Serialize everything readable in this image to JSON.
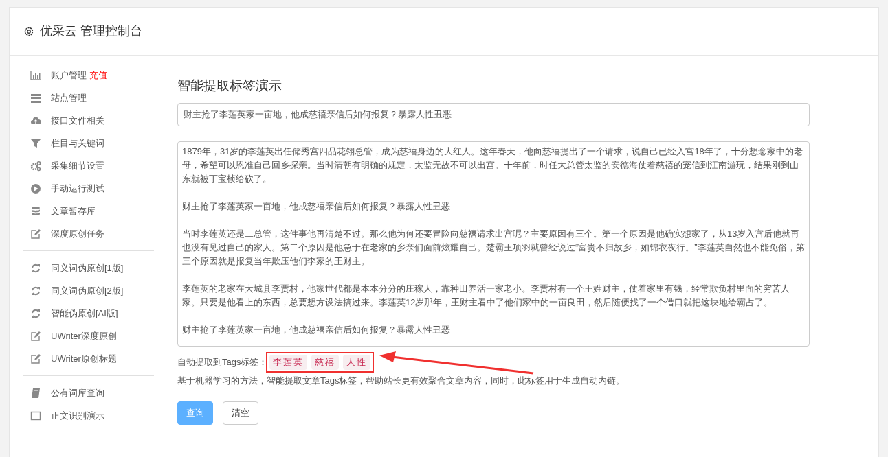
{
  "header": {
    "title": "优采云 管理控制台"
  },
  "sidebar": {
    "groups": [
      {
        "items": [
          {
            "kind": "chart",
            "label": "账户管理",
            "badge": "充值"
          },
          {
            "kind": "server",
            "label": "站点管理"
          },
          {
            "kind": "cloud",
            "label": "接口文件相关"
          },
          {
            "kind": "filter",
            "label": "栏目与关键词"
          },
          {
            "kind": "gears",
            "label": "采集细节设置"
          },
          {
            "kind": "play",
            "label": "手动运行测试"
          },
          {
            "kind": "database",
            "label": "文章暂存库"
          },
          {
            "kind": "edit",
            "label": "深度原创任务"
          }
        ]
      },
      {
        "items": [
          {
            "kind": "refresh",
            "label": "同义词伪原创[1版]"
          },
          {
            "kind": "refresh",
            "label": "同义词伪原创[2版]"
          },
          {
            "kind": "refresh",
            "label": "智能伪原创[AI版]"
          },
          {
            "kind": "edit",
            "label": "UWriter深度原创"
          },
          {
            "kind": "edit",
            "label": "UWriter原创标题"
          }
        ]
      },
      {
        "items": [
          {
            "kind": "book",
            "label": "公有词库查询"
          },
          {
            "kind": "square",
            "label": "正文识别演示"
          }
        ]
      }
    ]
  },
  "main": {
    "heading": "智能提取标签演示",
    "title_field": {
      "value": "财主抢了李莲英家一亩地，他成慈禧亲信后如何报复？暴露人性丑恶"
    },
    "content_field": {
      "paragraphs": [
        "1879年，31岁的李莲英出任储秀宫四品花翎总管，成为慈禧身边的大红人。这年春天，他向慈禧提出了一个请求，说自己已经入宫18年了，十分想念家中的老母，希望可以恩准自己回乡探亲。当时清朝有明确的规定，太监无故不可以出宫。十年前，时任大总管太监的安德海仗着慈禧的宠信到江南游玩，结果刚到山东就被丁宝桢给砍了。",
        "财主抢了李莲英家一亩地，他成慈禧亲信后如何报复？暴露人性丑恶",
        "当时李莲英还是二总管，这件事他再清楚不过。那么他为何还要冒险向慈禧请求出宫呢？主要原因有三个。第一个原因是他确实想家了，从13岁入宫后他就再也没有见过自己的家人。第二个原因是他急于在老家的乡亲们面前炫耀自己。楚霸王项羽就曾经说过“富贵不归故乡，如锦衣夜行。”李莲英自然也不能免俗，第三个原因就是报复当年欺压他们李家的王财主。",
        "李莲英的老家在大城县李贾村，他家世代都是本本分分的庄稼人，靠种田养活一家老小。李贾村有一个王姓财主，仗着家里有钱，经常欺负村里面的穷苦人家。只要是他看上的东西，总要想方设法搞过来。李莲英12岁那年，王财主看中了他们家中的一亩良田，然后随便找了一个借口就把这块地给霸占了。",
        "财主抢了李莲英家一亩地，他成慈禧亲信后如何报复？暴露人性丑恶"
      ]
    },
    "tags_label": "自动提取到Tags标签：",
    "tags": [
      "李莲英",
      "慈禧",
      "人性"
    ],
    "description": "基于机器学习的方法，智能提取文章Tags标签，帮助站长更有效聚合文章内容，同时，此标签用于生成自动内链。",
    "buttons": [
      {
        "kind": "primary",
        "label": "查询"
      },
      {
        "kind": "default",
        "label": "清空"
      }
    ]
  }
}
